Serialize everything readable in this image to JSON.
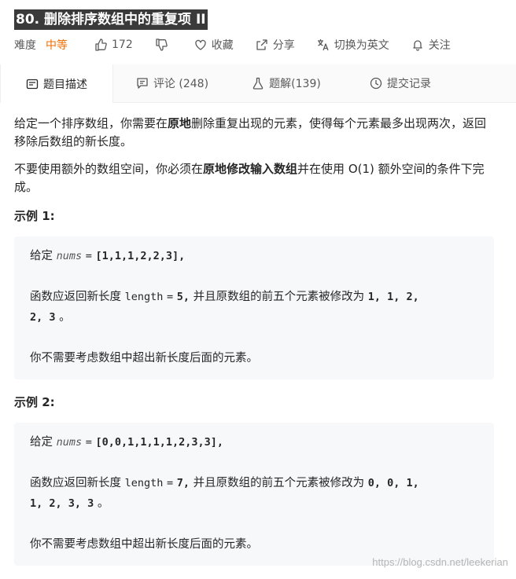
{
  "problem": {
    "title": "80. 删除排序数组中的重复项 II"
  },
  "meta": {
    "difficulty_label": "难度",
    "difficulty": "中等",
    "likes": "172",
    "favorite": "收藏",
    "share": "分享",
    "switch_lang": "切换为英文",
    "follow": "关注"
  },
  "tabs": [
    {
      "label": "题目描述",
      "icon": "description-icon"
    },
    {
      "label": "评论 (248)",
      "icon": "comment-icon"
    },
    {
      "label": "题解(139)",
      "icon": "flask-icon"
    },
    {
      "label": "提交记录",
      "icon": "clock-icon"
    }
  ],
  "description": {
    "p1_a": "给定一个排序数组，你需要在",
    "p1_hl": "原地",
    "p1_b": "删除重复出现的元素，使得每个元素最多出现两次，返回移除后数组的新长度。",
    "p2_a": "不要使用额外的数组空间，你必须在",
    "p2_hl1": "原地",
    "p2_hl2": "修改输入数组",
    "p2_b": "并在使用 O(1) 额外空间的条件下完成。"
  },
  "examples": [
    {
      "title": "示例 1:",
      "given": "给定",
      "var": "nums",
      "eq": "=",
      "array": "[1,1,1,2,2,3],",
      "ret_a": "函数应返回新长度",
      "ret_var": "length",
      "ret_eq": "=",
      "ret_num": "5,",
      "ret_b": "并且原数组的前五个元素被修改为",
      "ret_vals1": "1, 1, 2,",
      "ret_vals2": "2, 3",
      "ret_end": "。",
      "note": "你不需要考虑数组中超出新长度后面的元素。"
    },
    {
      "title": "示例 2:",
      "given": "给定",
      "var": "nums",
      "eq": "=",
      "array": "[0,0,1,1,1,1,2,3,3],",
      "ret_a": "函数应返回新长度",
      "ret_var": "length",
      "ret_eq": "=",
      "ret_num": "7,",
      "ret_b": "并且原数组的前五个元素被修改为",
      "ret_vals1": "0, 0, 1,",
      "ret_vals2": "1, 2, 3, 3",
      "ret_end": "。",
      "note": "你不需要考虑数组中超出新长度后面的元素。"
    }
  ],
  "watermark": "https://blog.csdn.net/leekerian",
  "colors": {
    "difficulty": "#ef6c00",
    "title_bg": "#3a3a3a",
    "code_bg": "#f7f8fa"
  }
}
